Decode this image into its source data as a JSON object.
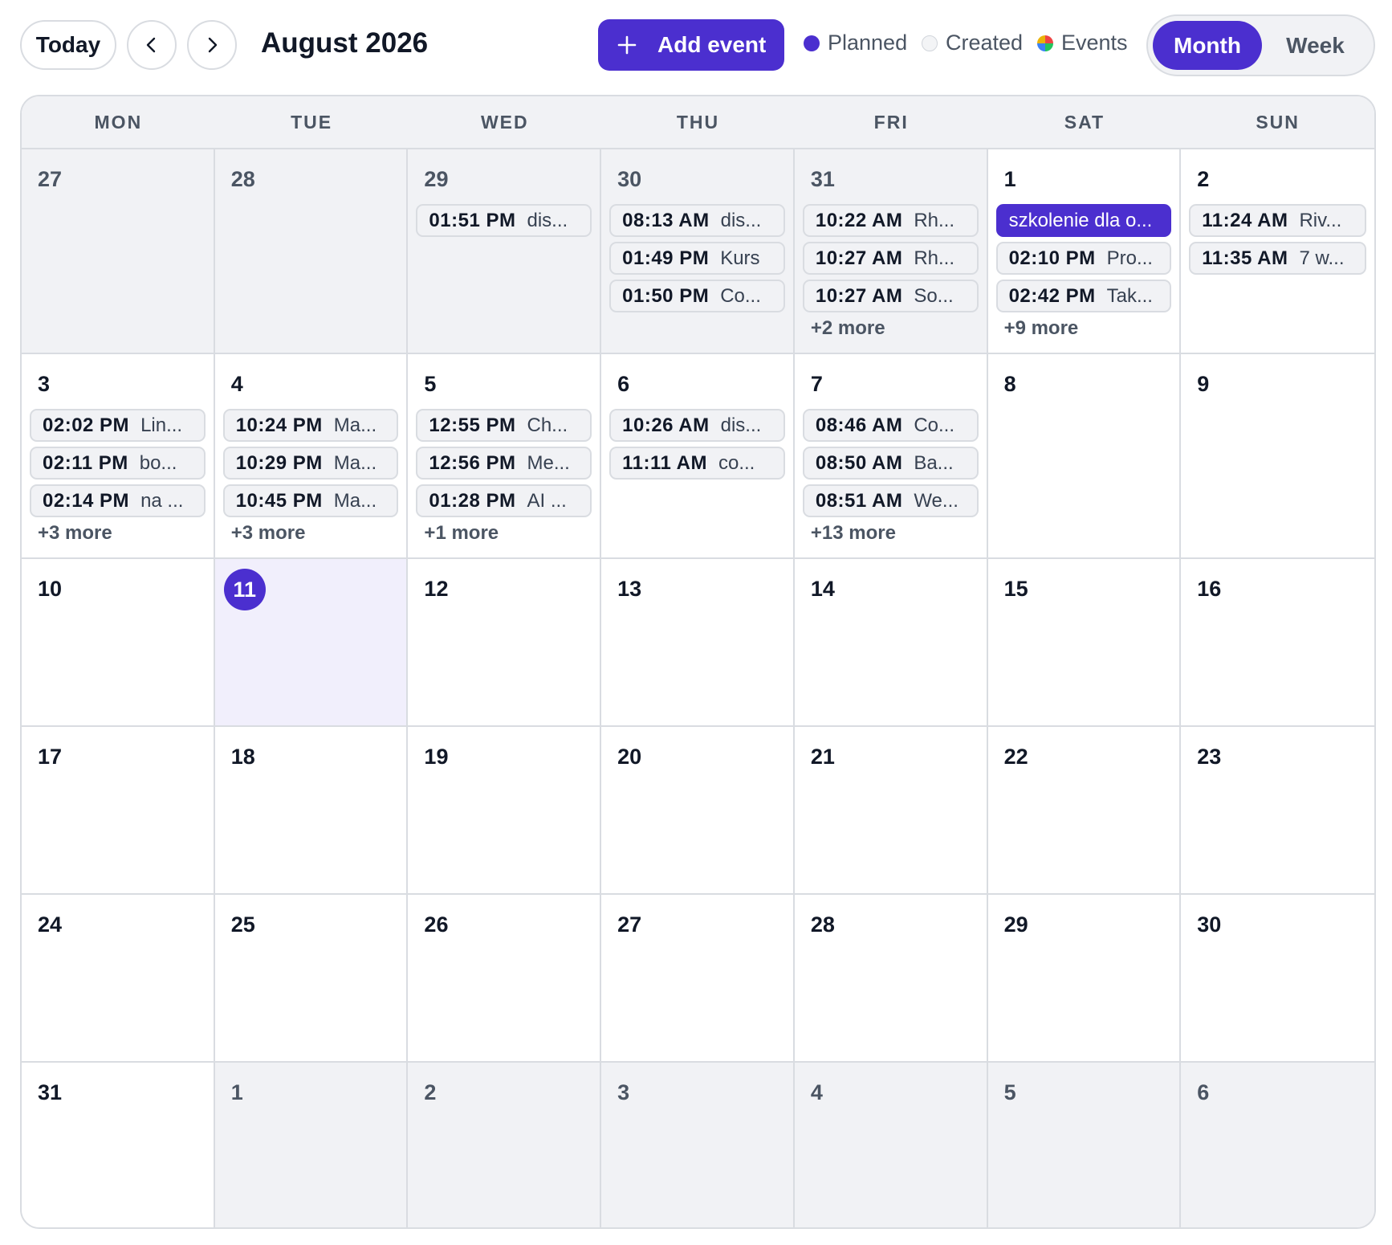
{
  "toolbar": {
    "today_label": "Today",
    "month_title": "August 2026",
    "add_event_label": "Add event",
    "legend": {
      "planned": "Planned",
      "created": "Created",
      "events": "Events"
    },
    "views": {
      "month": "Month",
      "week": "Week"
    },
    "active_view": "Month"
  },
  "colors": {
    "accent": "#4b2fcf",
    "cell_muted": "#f1f2f5",
    "today_bg": "#f1effc",
    "border": "#d9dce1"
  },
  "weekdays": [
    "MON",
    "TUE",
    "WED",
    "THU",
    "FRI",
    "SAT",
    "SUN"
  ],
  "weeks": [
    [
      {
        "day": "27",
        "outside": true,
        "events": []
      },
      {
        "day": "28",
        "outside": true,
        "events": []
      },
      {
        "day": "29",
        "outside": true,
        "events": [
          {
            "time": "01:51 PM",
            "title": "dis..."
          }
        ]
      },
      {
        "day": "30",
        "outside": true,
        "events": [
          {
            "time": "08:13 AM",
            "title": "dis..."
          },
          {
            "time": "01:49 PM",
            "title": "Kurs"
          },
          {
            "time": "01:50 PM",
            "title": "Co..."
          }
        ]
      },
      {
        "day": "31",
        "outside": true,
        "events": [
          {
            "time": "10:22 AM",
            "title": "Rh..."
          },
          {
            "time": "10:27 AM",
            "title": "Rh..."
          },
          {
            "time": "10:27 AM",
            "title": "So..."
          }
        ],
        "more": "+2 more"
      },
      {
        "day": "1",
        "events": [
          {
            "time": "",
            "title": "szkolenie dla o...",
            "planned": true
          },
          {
            "time": "02:10 PM",
            "title": "Pro..."
          },
          {
            "time": "02:42 PM",
            "title": "Tak..."
          }
        ],
        "more": "+9 more"
      },
      {
        "day": "2",
        "events": [
          {
            "time": "11:24 AM",
            "title": "Riv..."
          },
          {
            "time": "11:35 AM",
            "title": "7 w..."
          }
        ]
      }
    ],
    [
      {
        "day": "3",
        "events": [
          {
            "time": "02:02 PM",
            "title": "Lin..."
          },
          {
            "time": "02:11 PM",
            "title": "bo..."
          },
          {
            "time": "02:14 PM",
            "title": "na ..."
          }
        ],
        "more": "+3 more"
      },
      {
        "day": "4",
        "events": [
          {
            "time": "10:24 PM",
            "title": "Ma..."
          },
          {
            "time": "10:29 PM",
            "title": "Ma..."
          },
          {
            "time": "10:45 PM",
            "title": "Ma..."
          }
        ],
        "more": "+3 more"
      },
      {
        "day": "5",
        "events": [
          {
            "time": "12:55 PM",
            "title": "Ch..."
          },
          {
            "time": "12:56 PM",
            "title": "Me..."
          },
          {
            "time": "01:28 PM",
            "title": "AI ..."
          }
        ],
        "more": "+1 more"
      },
      {
        "day": "6",
        "events": [
          {
            "time": "10:26 AM",
            "title": "dis..."
          },
          {
            "time": "11:11 AM",
            "title": "co..."
          }
        ]
      },
      {
        "day": "7",
        "events": [
          {
            "time": "08:46 AM",
            "title": "Co..."
          },
          {
            "time": "08:50 AM",
            "title": "Ba..."
          },
          {
            "time": "08:51 AM",
            "title": "We..."
          }
        ],
        "more": "+13 more"
      },
      {
        "day": "8",
        "events": []
      },
      {
        "day": "9",
        "events": []
      }
    ],
    [
      {
        "day": "10",
        "events": []
      },
      {
        "day": "11",
        "today": true,
        "events": []
      },
      {
        "day": "12",
        "events": []
      },
      {
        "day": "13",
        "events": []
      },
      {
        "day": "14",
        "events": []
      },
      {
        "day": "15",
        "events": []
      },
      {
        "day": "16",
        "events": []
      }
    ],
    [
      {
        "day": "17",
        "events": []
      },
      {
        "day": "18",
        "events": []
      },
      {
        "day": "19",
        "events": []
      },
      {
        "day": "20",
        "events": []
      },
      {
        "day": "21",
        "events": []
      },
      {
        "day": "22",
        "events": []
      },
      {
        "day": "23",
        "events": []
      }
    ],
    [
      {
        "day": "24",
        "events": []
      },
      {
        "day": "25",
        "events": []
      },
      {
        "day": "26",
        "events": []
      },
      {
        "day": "27",
        "events": []
      },
      {
        "day": "28",
        "events": []
      },
      {
        "day": "29",
        "events": []
      },
      {
        "day": "30",
        "events": []
      }
    ],
    [
      {
        "day": "31",
        "events": []
      },
      {
        "day": "1",
        "outside": true,
        "events": []
      },
      {
        "day": "2",
        "outside": true,
        "events": []
      },
      {
        "day": "3",
        "outside": true,
        "events": []
      },
      {
        "day": "4",
        "outside": true,
        "events": []
      },
      {
        "day": "5",
        "outside": true,
        "events": []
      },
      {
        "day": "6",
        "outside": true,
        "events": []
      }
    ]
  ]
}
